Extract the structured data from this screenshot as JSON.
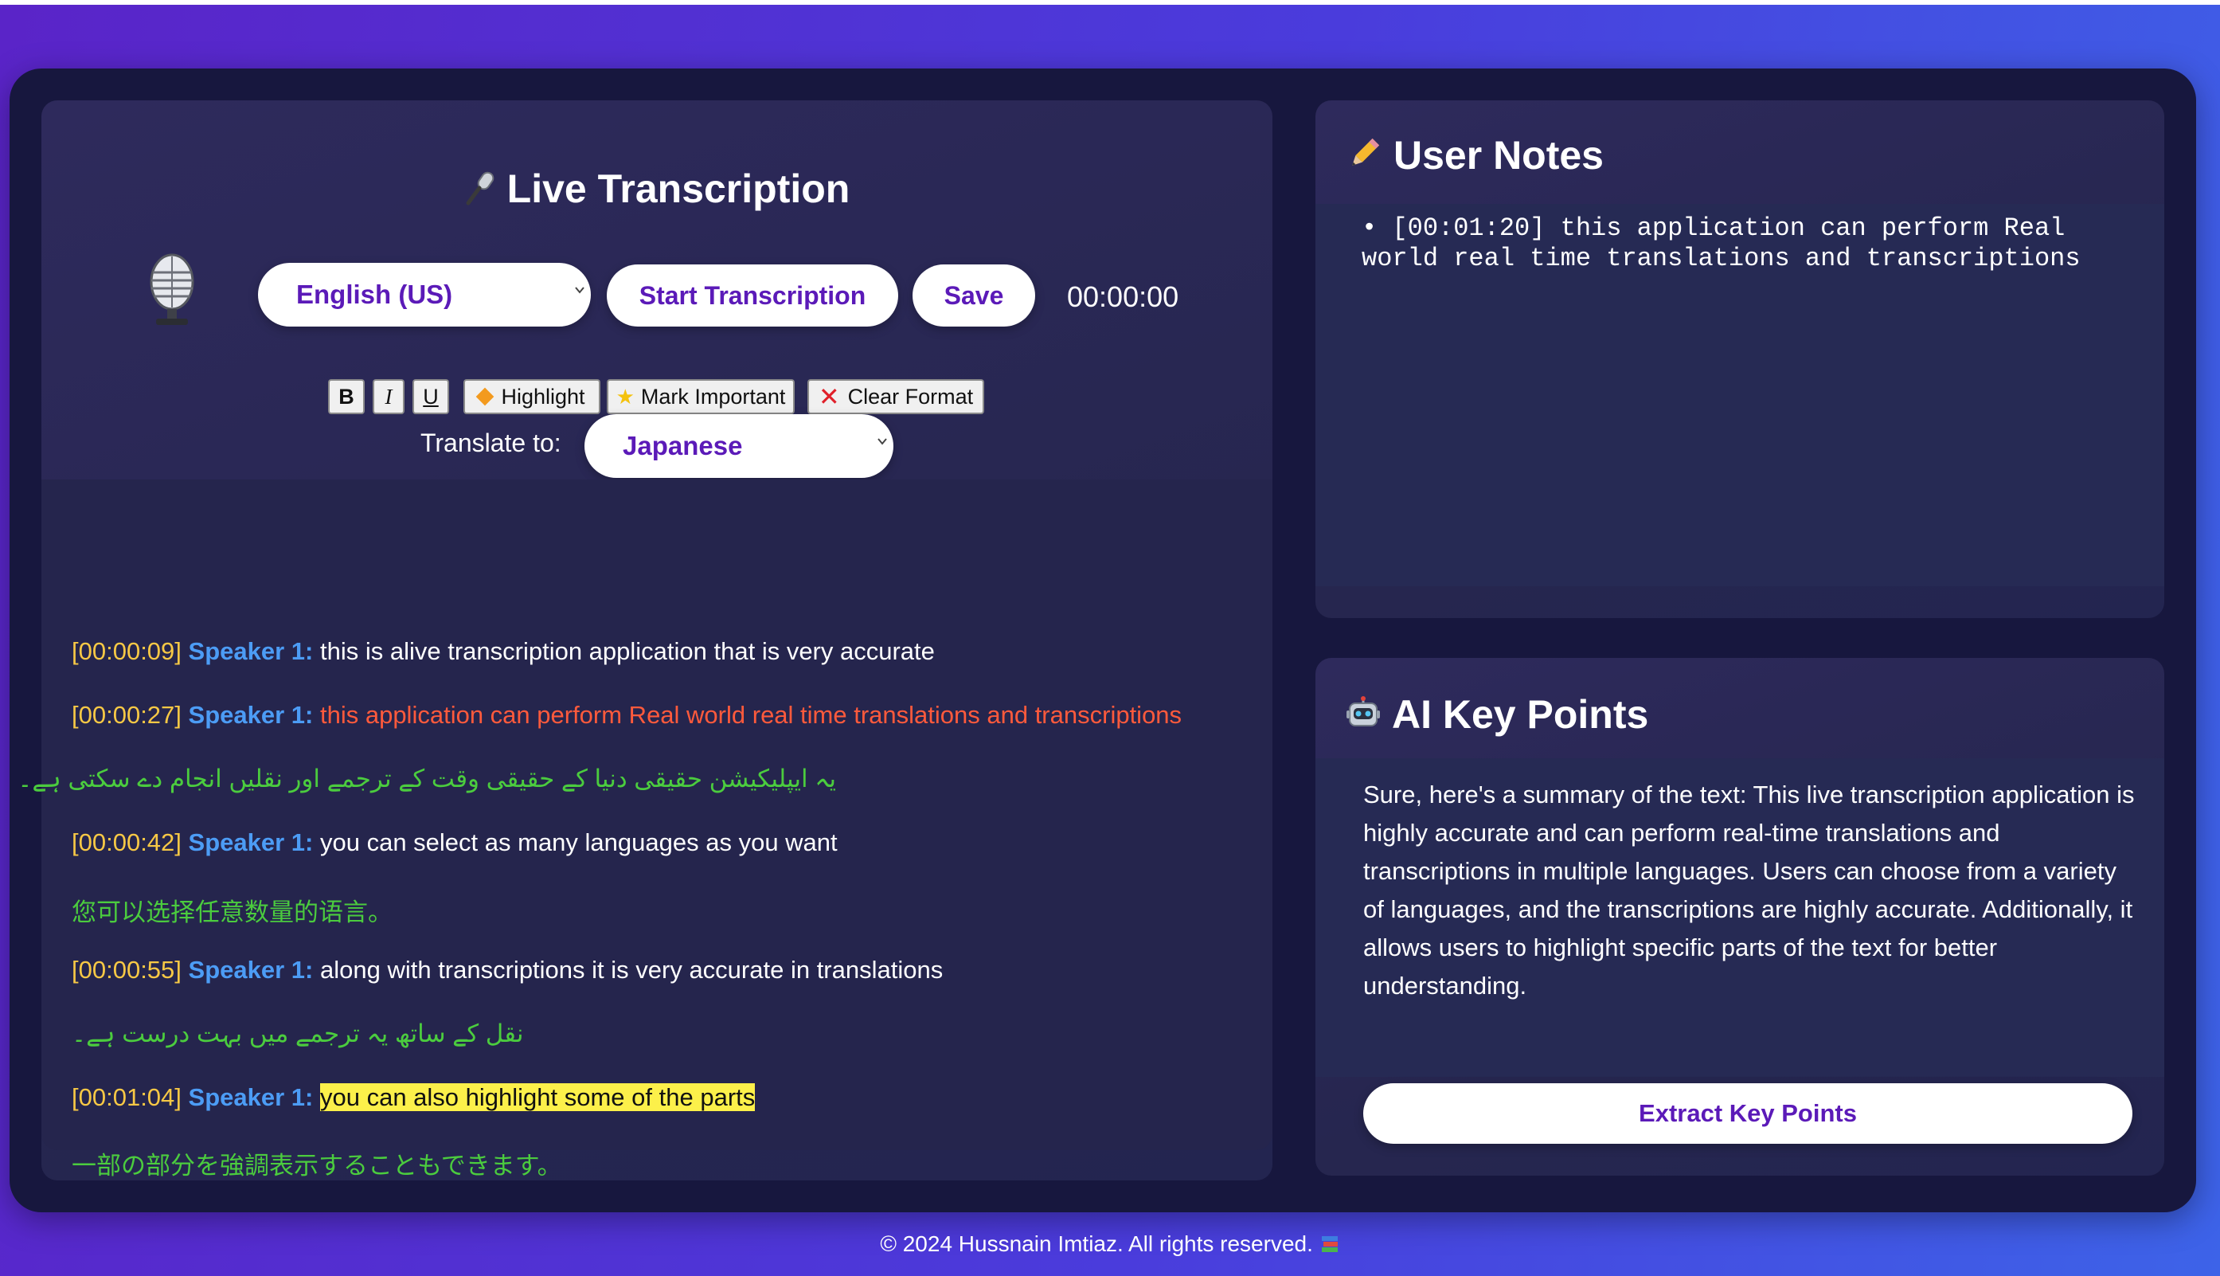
{
  "transcription": {
    "title": "Live Transcription",
    "title_icon": "microphone-icon",
    "language": "English (US)",
    "start_label": "Start Transcription",
    "save_label": "Save",
    "timer": "00:00:00",
    "format": {
      "bold": "B",
      "italic": "I",
      "underline": "U",
      "highlight": "Highlight",
      "mark_important": "Mark Important",
      "clear_format": "Clear Format"
    },
    "translate_label": "Translate to:",
    "translate_language": "Japanese",
    "entries": [
      {
        "time": "[00:00:09]",
        "speaker": "Speaker 1:",
        "text": "this is alive transcription application that is very accurate"
      },
      {
        "time": "[00:00:27]",
        "speaker": "Speaker 1:",
        "text": "this application can perform Real world real time translations and transcriptions",
        "translation": "یہ ایپلیکیشن حقیقی دنیا کے حقیقی وقت کے ترجمے اور نقلیں انجام دے سکتی ہے۔"
      },
      {
        "time": "[00:00:42]",
        "speaker": "Speaker 1:",
        "text": "you can select as many languages as you want",
        "translation": "您可以选择任意数量的语言。"
      },
      {
        "time": "[00:00:55]",
        "speaker": "Speaker 1:",
        "text": "along with transcriptions it is very accurate in translations",
        "translation": "نقل کے ساتھ یہ ترجمے میں بہت درست ہے۔"
      },
      {
        "time": "[00:01:04]",
        "speaker": "Speaker 1:",
        "text": "you can also highlight some of the parts",
        "translation": "一部の部分を強調表示することもできます。"
      }
    ]
  },
  "notes": {
    "title": "User Notes",
    "title_icon": "pencil-icon",
    "content": "• [00:01:20] this application can perform Real world real time translations and transcriptions"
  },
  "ai": {
    "title": "AI Key Points",
    "title_icon": "robot-icon",
    "summary": "Sure, here's a summary of the text: This live transcription application is highly accurate and can perform real-time translations and transcriptions in multiple languages. Users can choose from a variety of languages, and the transcriptions are highly accurate. Additionally, it allows users to highlight specific parts of the text for better understanding.",
    "extract_label": "Extract Key Points"
  },
  "footer": {
    "text": "© 2024 Hussnain Imtiaz. All rights reserved.",
    "icon": "books-icon"
  },
  "colors": {
    "accent": "#5b1ab8",
    "timestamp": "#f7c845",
    "speaker": "#4c9cf5",
    "translation": "#4bcc3e",
    "important": "#ff5a3c",
    "highlight": "#fcf04a"
  }
}
